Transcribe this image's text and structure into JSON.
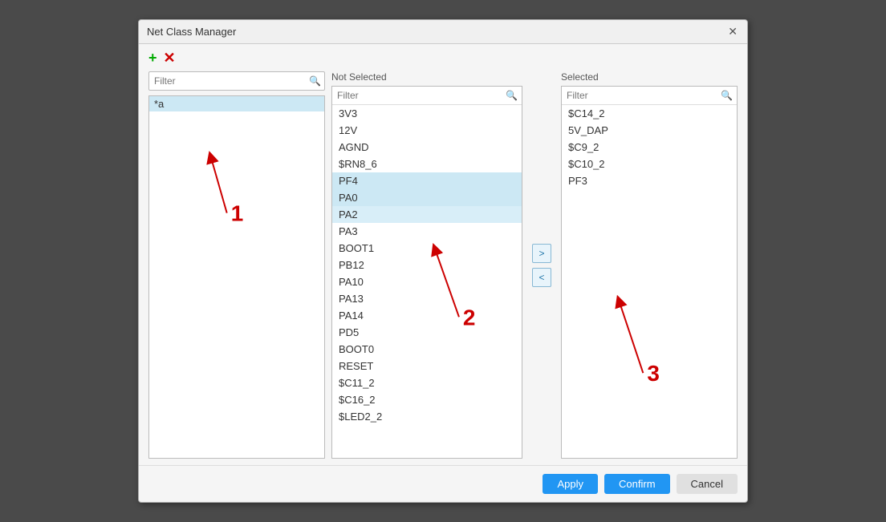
{
  "dialog": {
    "title": "Net Class Manager",
    "close_label": "✕"
  },
  "toolbar": {
    "add_label": "+",
    "remove_label": "✕"
  },
  "left_panel": {
    "filter_placeholder": "Filter",
    "items": [
      {
        "label": "*a",
        "selected": true
      }
    ]
  },
  "middle_panel": {
    "panel_label": "Not Selected",
    "filter_placeholder": "Filter",
    "items": [
      {
        "label": "3V3",
        "selected": false
      },
      {
        "label": "12V",
        "selected": false
      },
      {
        "label": "AGND",
        "selected": false
      },
      {
        "label": "$RN8_6",
        "selected": false
      },
      {
        "label": "PF4",
        "selected": true
      },
      {
        "label": "PA0",
        "selected": true
      },
      {
        "label": "PA2",
        "selected": true
      },
      {
        "label": "PA3",
        "selected": false
      },
      {
        "label": "BOOT1",
        "selected": false
      },
      {
        "label": "PB12",
        "selected": false
      },
      {
        "label": "PA10",
        "selected": false
      },
      {
        "label": "PA13",
        "selected": false
      },
      {
        "label": "PA14",
        "selected": false
      },
      {
        "label": "PD5",
        "selected": false
      },
      {
        "label": "BOOT0",
        "selected": false
      },
      {
        "label": "RESET",
        "selected": false
      },
      {
        "label": "$C11_2",
        "selected": false
      },
      {
        "label": "$C16_2",
        "selected": false
      },
      {
        "label": "$LED2_2",
        "selected": false
      }
    ]
  },
  "transfer": {
    "move_right_label": ">",
    "move_left_label": "<"
  },
  "right_panel": {
    "panel_label": "Selected",
    "filter_placeholder": "Filter",
    "items": [
      {
        "label": "$C14_2"
      },
      {
        "label": "5V_DAP"
      },
      {
        "label": "$C9_2"
      },
      {
        "label": "$C10_2"
      },
      {
        "label": "PF3"
      }
    ]
  },
  "footer": {
    "apply_label": "Apply",
    "confirm_label": "Confirm",
    "cancel_label": "Cancel"
  },
  "annotations": {
    "1_label": "1",
    "2_label": "2",
    "3_label": "3"
  }
}
